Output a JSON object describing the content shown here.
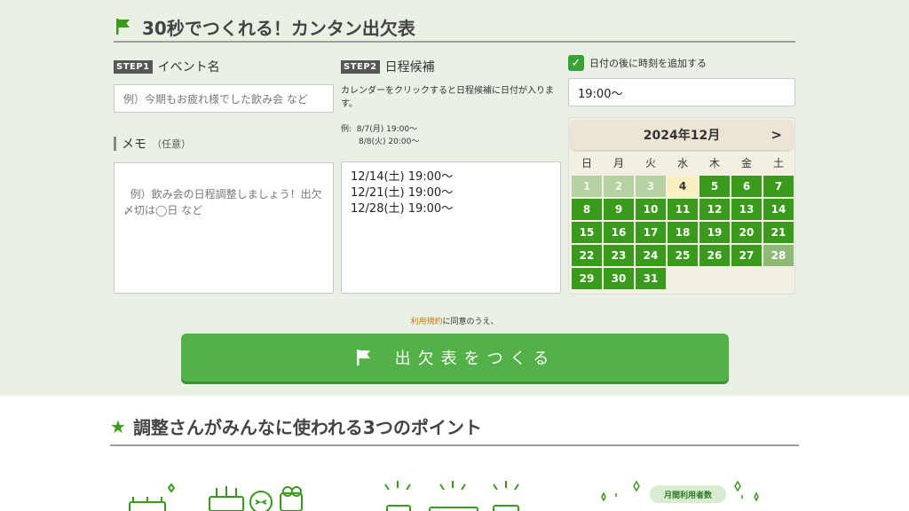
{
  "header": {
    "title": "30秒でつくれる！カンタン出欠表"
  },
  "step1": {
    "badge": "STEP1",
    "label": "イベント名",
    "placeholder": "例）今期もお疲れ様でした飲み会 など"
  },
  "memo": {
    "label": "メモ",
    "optional": "（任意）",
    "placeholder": "例）飲み会の日程調整しましょう！出欠〆切は◯日 など"
  },
  "step2": {
    "badge": "STEP2",
    "label": "日程候補",
    "description": "カレンダーをクリックすると日程候補に日付が入ります。",
    "example_prefix": "例:",
    "example_line1": "8/7(月) 19:00〜",
    "example_line2": "8/8(火) 20:00〜",
    "candidates": "12/14(土) 19:00〜\n12/21(土) 19:00〜\n12/28(土) 19:00〜"
  },
  "time_option": {
    "label": "日付の後に時刻を追加する",
    "checked": true,
    "value": "19:00〜"
  },
  "calendar": {
    "month_label": "2024年12月",
    "next": ">",
    "weekdays": [
      "日",
      "月",
      "火",
      "水",
      "木",
      "金",
      "土"
    ],
    "days": [
      {
        "d": "1",
        "s": "past"
      },
      {
        "d": "2",
        "s": "past"
      },
      {
        "d": "3",
        "s": "past"
      },
      {
        "d": "4",
        "s": "today"
      },
      {
        "d": "5",
        "s": "open"
      },
      {
        "d": "6",
        "s": "open"
      },
      {
        "d": "7",
        "s": "open"
      },
      {
        "d": "8",
        "s": "open"
      },
      {
        "d": "9",
        "s": "open"
      },
      {
        "d": "10",
        "s": "open"
      },
      {
        "d": "11",
        "s": "open"
      },
      {
        "d": "12",
        "s": "open"
      },
      {
        "d": "13",
        "s": "open"
      },
      {
        "d": "14",
        "s": "open"
      },
      {
        "d": "15",
        "s": "open"
      },
      {
        "d": "16",
        "s": "open"
      },
      {
        "d": "17",
        "s": "open"
      },
      {
        "d": "18",
        "s": "open"
      },
      {
        "d": "19",
        "s": "open"
      },
      {
        "d": "20",
        "s": "open"
      },
      {
        "d": "21",
        "s": "open"
      },
      {
        "d": "22",
        "s": "open"
      },
      {
        "d": "23",
        "s": "open"
      },
      {
        "d": "24",
        "s": "open"
      },
      {
        "d": "25",
        "s": "open"
      },
      {
        "d": "26",
        "s": "open"
      },
      {
        "d": "27",
        "s": "open"
      },
      {
        "d": "28",
        "s": "faded"
      },
      {
        "d": "29",
        "s": "open"
      },
      {
        "d": "30",
        "s": "open"
      },
      {
        "d": "31",
        "s": "open"
      }
    ]
  },
  "terms": {
    "link": "利用規約",
    "text": "に同意のうえ、"
  },
  "create_button": {
    "label": "出欠表をつくる"
  },
  "points": {
    "title": "調整さんがみんなに使われる3つのポイント",
    "badge": "月間利用者数"
  },
  "colors": {
    "accent": "#52b147",
    "calendar_day": "#3a9a1c",
    "background": "#e8f1e4"
  }
}
